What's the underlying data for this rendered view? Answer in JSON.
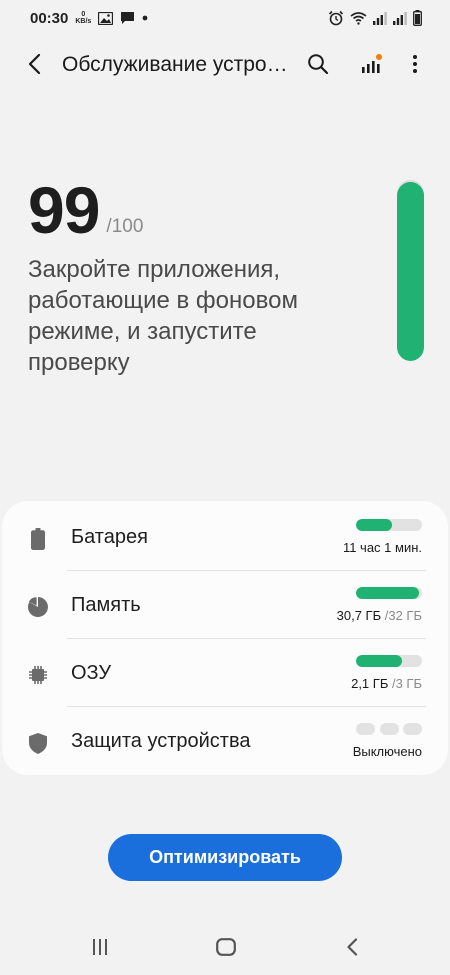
{
  "status_bar": {
    "time": "00:30",
    "net_speed_value": "0",
    "net_speed_unit": "KB/s",
    "icons": [
      "image-icon",
      "message-icon",
      "dot-icon",
      "alarm-icon",
      "wifi-icon",
      "signal-icon",
      "signal-icon",
      "battery-icon"
    ]
  },
  "toolbar": {
    "title": "Обслуживание устройства",
    "icons": [
      "back-icon",
      "search-icon",
      "stats-icon",
      "more-icon"
    ],
    "badge_color": "#f57c00"
  },
  "score": {
    "value": "99",
    "max": "/100",
    "message": "Закройте приложения, работающие в фоновом режиме, и запустите проверку",
    "level": 0.99
  },
  "items": [
    {
      "label": "Батарея",
      "value": "11 час 1 мин.",
      "value_sub": "",
      "icon": "battery-icon",
      "level": 0.55
    },
    {
      "label": "Память",
      "value": "30,7 ГБ",
      "value_sub": " /32 ГБ",
      "icon": "storage-pie-icon",
      "level": 0.96
    },
    {
      "label": "ОЗУ",
      "value": "2,1 ГБ",
      "value_sub": " /3 ГБ",
      "icon": "memory-chip-icon",
      "level": 0.7
    },
    {
      "label": "Защита устройства",
      "value": "Выключено",
      "value_sub": "",
      "icon": "shield-icon",
      "level": 0
    }
  ],
  "actions": {
    "optimize_label": "Оптимизировать"
  },
  "colors": {
    "accent_green": "#20b272",
    "button_blue": "#1a6fdd",
    "background": "#f2f2f2"
  },
  "navbar": {
    "icons": [
      "recents-icon",
      "home-icon",
      "back-nav-icon"
    ]
  }
}
